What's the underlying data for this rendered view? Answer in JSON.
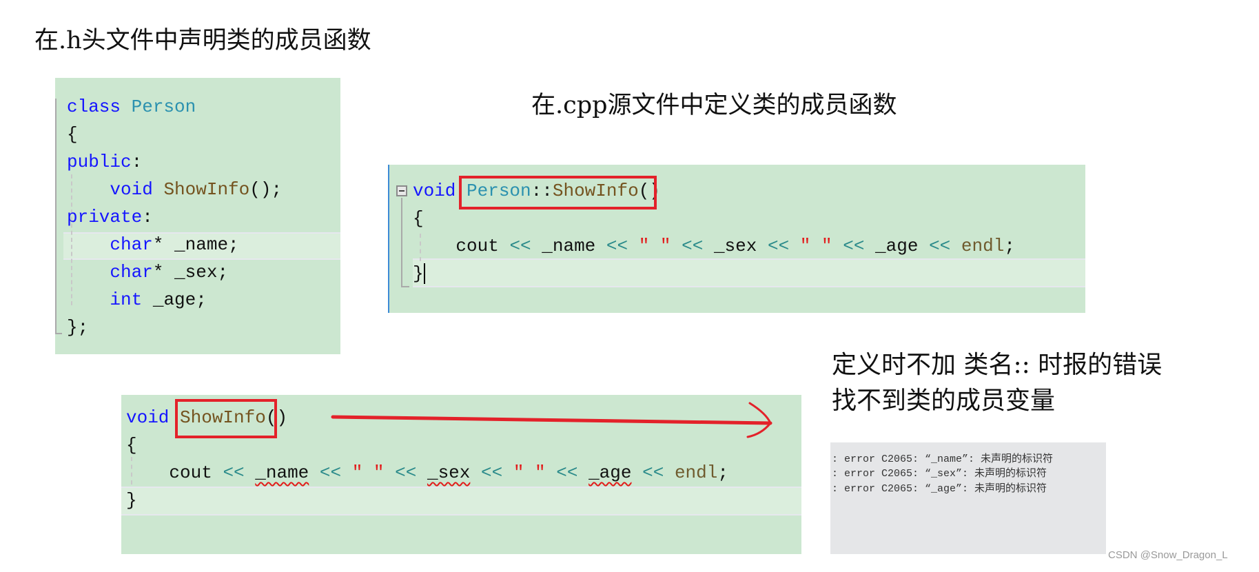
{
  "headings": {
    "header_file": "在.h头文件中声明类的成员函数",
    "cpp_file": "在.cpp源文件中定义类的成员函数",
    "note_line1": "定义时不加 类名:: 时报的错误",
    "note_line2": "找不到类的成员变量"
  },
  "header_code": [
    [
      [
        "class ",
        "kw"
      ],
      [
        "Person",
        "type"
      ]
    ],
    [
      [
        "{",
        "plain"
      ]
    ],
    [
      [
        "public",
        "kw"
      ],
      [
        ":",
        "plain"
      ]
    ],
    [
      [
        "    ",
        "plain"
      ],
      [
        "void ",
        "kw"
      ],
      [
        "ShowInfo",
        "fn"
      ],
      [
        "();",
        "plain"
      ]
    ],
    [
      [
        "private",
        "kw"
      ],
      [
        ":",
        "plain"
      ]
    ],
    [
      [
        "    ",
        "plain"
      ],
      [
        "char",
        "kw"
      ],
      [
        "* _name;",
        "plain"
      ]
    ],
    [
      [
        "    ",
        "plain"
      ],
      [
        "char",
        "kw"
      ],
      [
        "* _sex;",
        "plain"
      ]
    ],
    [
      [
        "    ",
        "plain"
      ],
      [
        "int ",
        "kw"
      ],
      [
        "_age;",
        "plain"
      ]
    ],
    [
      [
        "};",
        "plain"
      ]
    ]
  ],
  "cpp_code": [
    [
      [
        "void ",
        "kw"
      ],
      [
        "Person",
        "type"
      ],
      [
        "::",
        "plain"
      ],
      [
        "ShowInfo",
        "fn"
      ],
      [
        "()",
        "plain"
      ]
    ],
    [
      [
        "{",
        "plain"
      ]
    ],
    [
      [
        "    cout ",
        "plain"
      ],
      [
        "<<",
        "op"
      ],
      [
        " _name ",
        "plain"
      ],
      [
        "<<",
        "op"
      ],
      [
        " ",
        "plain"
      ],
      [
        "\" \"",
        "str"
      ],
      [
        " ",
        "plain"
      ],
      [
        "<<",
        "op"
      ],
      [
        " _sex ",
        "plain"
      ],
      [
        "<<",
        "op"
      ],
      [
        " ",
        "plain"
      ],
      [
        "\" \"",
        "str"
      ],
      [
        " ",
        "plain"
      ],
      [
        "<<",
        "op"
      ],
      [
        " _age ",
        "plain"
      ],
      [
        "<<",
        "op"
      ],
      [
        " ",
        "plain"
      ],
      [
        "endl",
        "macro"
      ],
      [
        ";",
        "plain"
      ]
    ],
    [
      [
        "}",
        "plain"
      ]
    ]
  ],
  "wrong_code": [
    [
      [
        "void ",
        "kw"
      ],
      [
        "ShowInfo",
        "fn"
      ],
      [
        "()",
        "plain"
      ]
    ],
    [
      [
        "{",
        "plain"
      ]
    ],
    [
      [
        "    cout ",
        "plain"
      ],
      [
        "<<",
        "op"
      ],
      [
        " ",
        "plain"
      ],
      [
        "_name",
        "squig"
      ],
      [
        " ",
        "plain"
      ],
      [
        "<<",
        "op"
      ],
      [
        " ",
        "plain"
      ],
      [
        "\" \"",
        "str"
      ],
      [
        " ",
        "plain"
      ],
      [
        "<<",
        "op"
      ],
      [
        " ",
        "plain"
      ],
      [
        "_sex",
        "squig"
      ],
      [
        " ",
        "plain"
      ],
      [
        "<<",
        "op"
      ],
      [
        " ",
        "plain"
      ],
      [
        "\" \"",
        "str"
      ],
      [
        " ",
        "plain"
      ],
      [
        "<<",
        "op"
      ],
      [
        " ",
        "plain"
      ],
      [
        "_age",
        "squig"
      ],
      [
        " ",
        "plain"
      ],
      [
        "<<",
        "op"
      ],
      [
        " ",
        "plain"
      ],
      [
        "endl",
        "macro"
      ],
      [
        ";",
        "plain"
      ]
    ],
    [
      [
        "}",
        "plain"
      ]
    ]
  ],
  "errors": [
    ": error C2065: “_name”: 未声明的标识符",
    ": error C2065: “_sex”: 未声明的标识符",
    ": error C2065: “_age”: 未声明的标识符"
  ],
  "watermark": "CSDN @Snow_Dragon_L",
  "colors": {
    "editor_bg": "#cce7d0",
    "keyword": "#1515ff",
    "type": "#2b91af",
    "function": "#74531f",
    "string": "#e21b1b",
    "annotation_red": "#e3222a"
  }
}
